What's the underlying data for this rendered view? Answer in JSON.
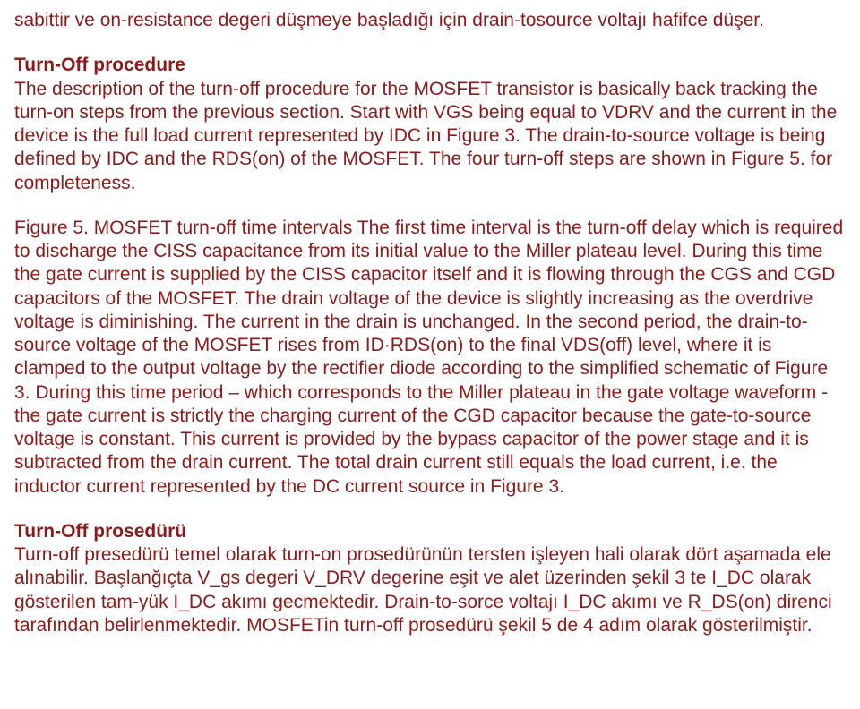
{
  "p1": "sabittir ve on-resistance degeri düşmeye başladığı için drain-tosource voltajı hafifce düşer.",
  "h1": "Turn-Off procedure",
  "p2": "The description of the turn-off procedure for the MOSFET transistor is basically back tracking the turn-on steps from the previous section. Start with VGS being equal to VDRV and the current in the device is the full load current represented by IDC in Figure 3. The drain-to-source voltage is being defined by IDC and the RDS(on) of the MOSFET. The four turn-off steps are shown in Figure 5. for completeness.",
  "p3": "Figure 5. MOSFET turn-off time intervals The first time interval is the turn-off delay which is required to  discharge the CISS capacitance from its initial value to the Miller plateau level. During this time the gate current is supplied by the CISS capacitor itself and it is flowing through the CGS and CGD capacitors of the MOSFET. The drain voltage of the device is slightly increasing as the overdrive voltage is diminishing. The current in the drain is unchanged. In the second period, the drain-to-source voltage of the MOSFET rises from ID·RDS(on) to the final VDS(off) level, where it is clamped to the output voltage by the rectifier diode according to the simplified schematic of Figure 3. During this time period – which corresponds to the Miller plateau in the gate voltage waveform - the gate current is strictly the charging current of the CGD capacitor because the gate-to-source voltage is constant. This current is provided by the bypass  capacitor of the power stage and it is subtracted from the drain current. The total drain current still equals the load current, i.e. the inductor current represented by the DC current source in Figure 3.",
  "h2": "Turn-Off prosedürü",
  "p4": "Turn-off presedürü temel olarak turn-on prosedürünün tersten işleyen hali olarak dört aşamada ele alınabilir. Başlanğıçta V_gs degeri V_DRV degerine eşit ve alet üzerinden  şekil 3 te I_DC olarak gösterilen tam-yük I_DC akımı gecmektedir. Drain-to-sorce voltajı I_DC akımı ve R_DS(on) direnci tarafından belirlenmektedir. MOSFETin turn-off prosedürü şekil 5 de 4 adım olarak gösterilmiştir."
}
